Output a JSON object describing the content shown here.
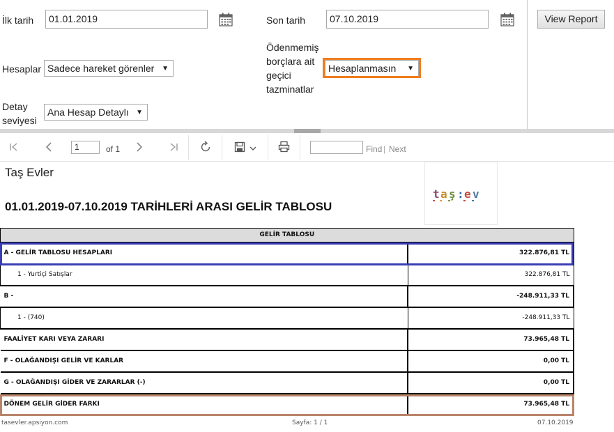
{
  "params": {
    "start_date_label": "İlk tarih",
    "start_date_value": "01.01.2019",
    "end_date_label": "Son tarih",
    "end_date_value": "07.10.2019",
    "accounts_label": "Hesaplar",
    "accounts_value": "Sadece hareket görenler",
    "unpaid_label_1": "Ödenmemiş",
    "unpaid_label_2": "borçlara ait",
    "unpaid_label_3": "geçici",
    "unpaid_label_4": "tazminatlar",
    "unpaid_value": "Hesaplanmasın",
    "detail_label_1": "Detay",
    "detail_label_2": "seviyesi",
    "detail_value": "Ana Hesap Detaylı",
    "view_report": "View Report"
  },
  "toolbar": {
    "page_value": "1",
    "page_of": "of 1",
    "find": "Find",
    "divider": "|",
    "next": "Next"
  },
  "report": {
    "company": "Taş Evler",
    "title": "01.01.2019-07.10.2019 TARİHLERİ ARASI GELİR TABLOSU",
    "logo_text": "taş:ev",
    "table_header": "GELİR TABLOSU",
    "rows": [
      {
        "name": "A - GELİR TABLOSU HESAPLARI",
        "amount": "322.876,81 TL"
      },
      {
        "name": "1 - Yurtiçi Satışlar",
        "amount": "322.876,81 TL"
      },
      {
        "name": "B -",
        "amount": "-248.911,33 TL"
      },
      {
        "name": "1 - (740)",
        "amount": "-248.911,33 TL"
      },
      {
        "name": "FAALİYET KARI VEYA ZARARI",
        "amount": "73.965,48 TL"
      },
      {
        "name": "F - OLAĞANDIŞI GELİR VE KARLAR",
        "amount": "0,00 TL"
      },
      {
        "name": "G - OLAĞANDIŞI GİDER VE ZARARLAR (-)",
        "amount": "0,00 TL"
      },
      {
        "name": "DÖNEM GELİR GİDER FARKI",
        "amount": "73.965,48 TL"
      }
    ],
    "footer_left": "tasevler.apsiyon.com",
    "footer_center": "Sayfa: 1 / 1",
    "footer_right": "07.10.2019"
  },
  "colors": {
    "highlight_blue": "#3a3db3",
    "highlight_orange": "#f07d1f",
    "highlight_brown": "#b8856b"
  }
}
